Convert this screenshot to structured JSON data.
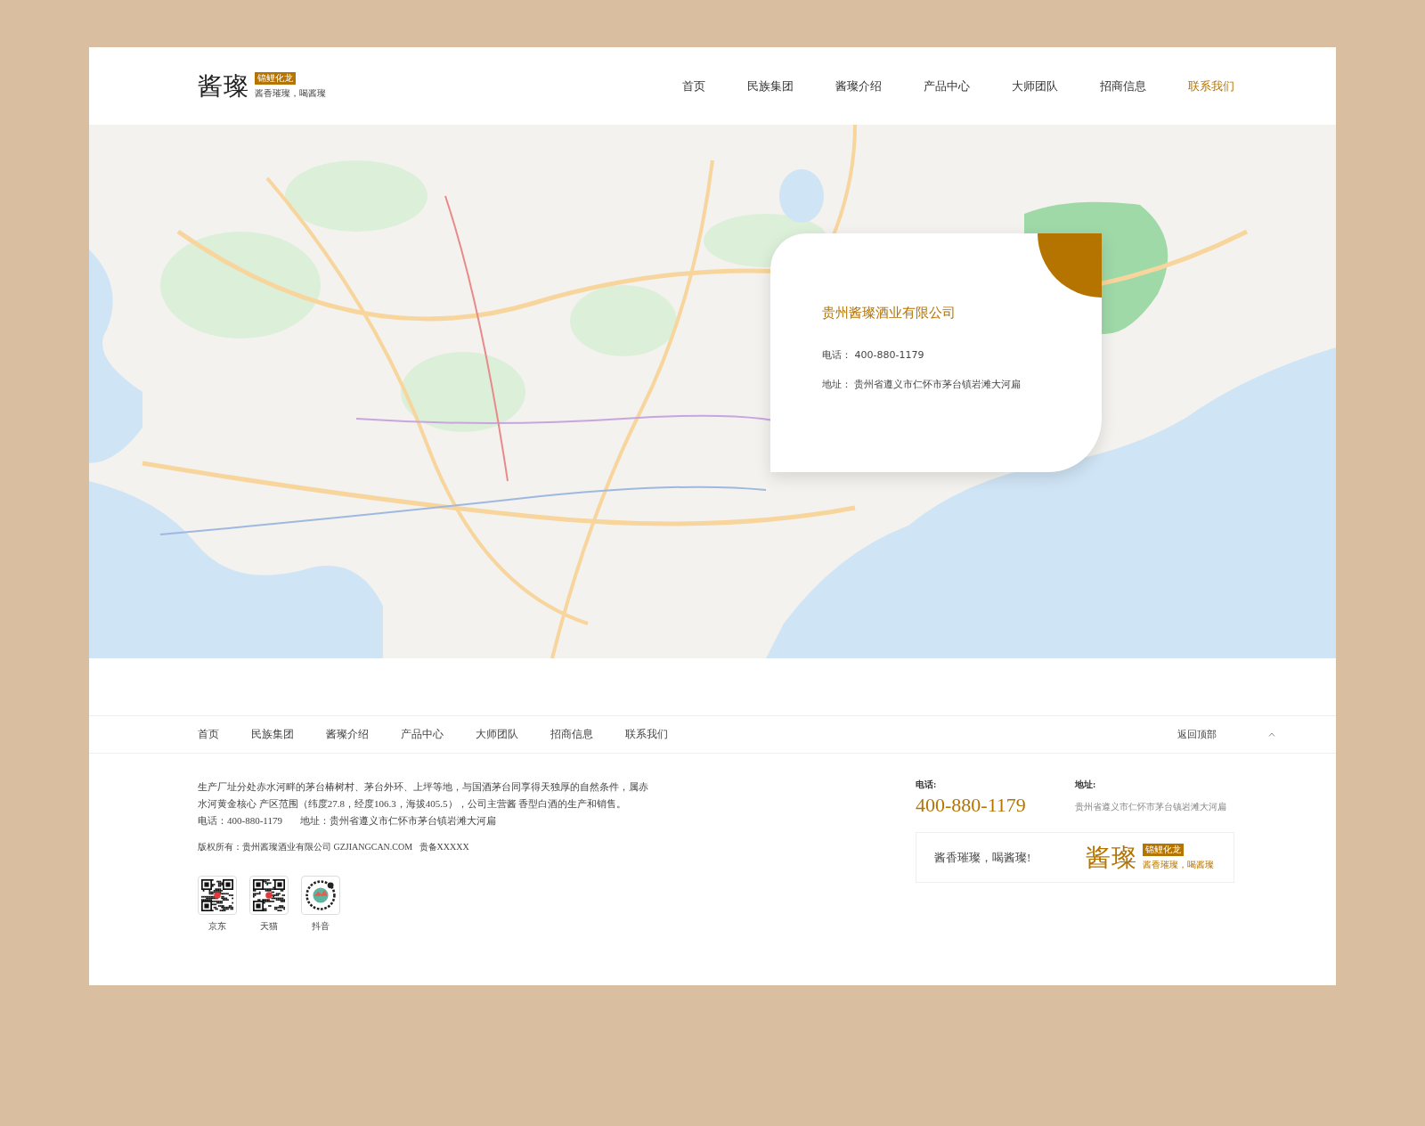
{
  "header": {
    "logo": {
      "name": "酱璨",
      "badge": "锦鲤化龙",
      "slogan": "酱香璀璨，喝酱璨"
    },
    "nav": [
      {
        "label": "首页",
        "selected": false
      },
      {
        "label": "民族集团",
        "selected": false
      },
      {
        "label": "酱璨介绍",
        "selected": false
      },
      {
        "label": "产品中心",
        "selected": false
      },
      {
        "label": "大师团队",
        "selected": false
      },
      {
        "label": "招商信息",
        "selected": false
      },
      {
        "label": "联系我们",
        "selected": true
      }
    ]
  },
  "contact_card": {
    "title": "贵州酱璨酒业有限公司",
    "phone": "电话： 400-880-1179",
    "address": "地址： 贵州省遵义市仁怀市茅台镇岩滩大河扁"
  },
  "footer": {
    "nav": [
      "首页",
      "民族集团",
      "酱璨介绍",
      "产品中心",
      "大师团队",
      "招商信息",
      "联系我们"
    ],
    "back_to_top": "返回顶部",
    "description": "生产厂址分处赤水河畔的茅台椿树村、茅台外环、上坪等地，与国酒茅台同享得天独厚的自然条件，属赤水河黄金核心 产区范围（纬度27.8，经度106.3，海拔405.5），公司主营酱 香型白酒的生产和销售。",
    "phone_line": "电话：400-880-1179",
    "address_line": "地址：贵州省遵义市仁怀市茅台镇岩滩大河扁",
    "copyright": "版权所有：贵州酱璨酒业有限公司 GZJIANGCAN.COM   贵备XXXXX",
    "qr_codes": [
      {
        "kind": "square",
        "label": "京东"
      },
      {
        "kind": "square",
        "label": "天猫"
      },
      {
        "kind": "round",
        "label": "抖音"
      }
    ],
    "contact": {
      "phone_label": "电话:",
      "phone": "400-880-1179",
      "address_label": "地址:",
      "address": "贵州省遵义市仁怀市茅台镇岩滩大河扁"
    },
    "slogan_box": {
      "text": "酱香璀璨，喝酱璨!",
      "logo": {
        "name": "酱璨",
        "badge": "锦鲤化龙",
        "slogan": "酱香璀璨，喝酱璨"
      }
    }
  }
}
